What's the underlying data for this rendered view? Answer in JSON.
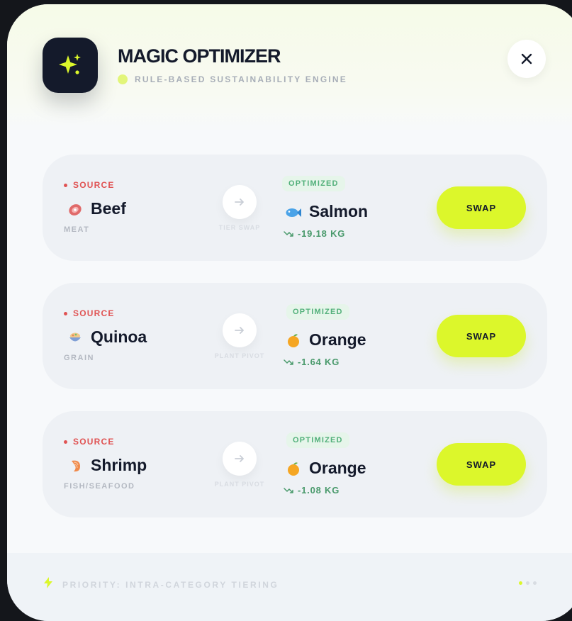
{
  "header": {
    "title": "MAGIC OPTIMIZER",
    "subtitle": "RULE-BASED SUSTAINABILITY ENGINE",
    "icon": "sparkles-icon",
    "close_icon": "close-icon"
  },
  "labels": {
    "source": "SOURCE",
    "optimized": "OPTIMIZED",
    "swap": "SWAP"
  },
  "swaps": [
    {
      "source_name": "Beef",
      "source_icon": "meat-icon",
      "source_category": "MEAT",
      "pivot_label": "TIER SWAP",
      "target_name": "Salmon",
      "target_icon": "fish-icon",
      "delta": "-19.18 KG"
    },
    {
      "source_name": "Quinoa",
      "source_icon": "grain-bowl-icon",
      "source_category": "GRAIN",
      "pivot_label": "PLANT PIVOT",
      "target_name": "Orange",
      "target_icon": "orange-icon",
      "delta": "-1.64 KG"
    },
    {
      "source_name": "Shrimp",
      "source_icon": "shrimp-icon",
      "source_category": "FISH/SEAFOOD",
      "pivot_label": "PLANT PIVOT",
      "target_name": "Orange",
      "target_icon": "orange-icon",
      "delta": "-1.08 KG"
    }
  ],
  "footer": {
    "priority": "PRIORITY: INTRA-CATEGORY TIERING",
    "icon": "lightning-icon",
    "pages": 3,
    "active_page": 1
  },
  "colors": {
    "accent": "#dcf72b",
    "dark": "#141a2b",
    "source_red": "#e05353",
    "optimized_green": "#52b07a"
  }
}
